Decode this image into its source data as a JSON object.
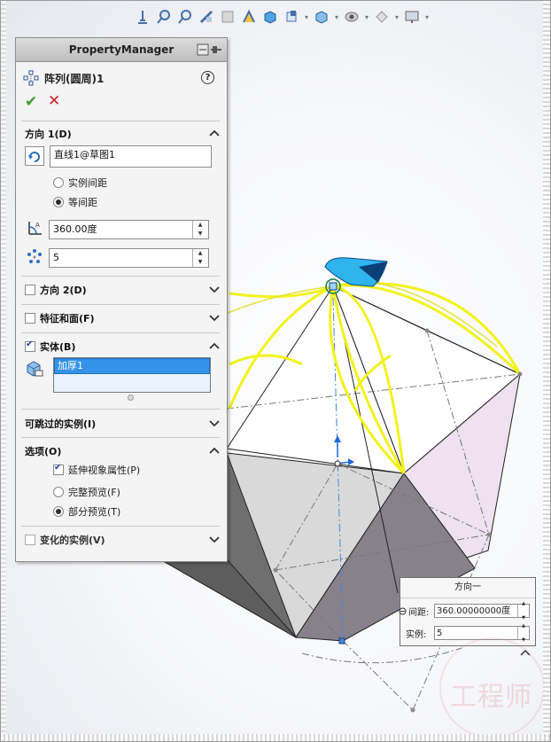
{
  "property_manager": {
    "title": "PropertyManager",
    "feature_name": "阵列(圆周)1",
    "help_icon": "?",
    "ok_icon": "✔",
    "cancel_icon": "✕",
    "direction1": {
      "label": "方向 1(D)",
      "axis_value": "直线1@草图1",
      "option_instance_spacing": "实例间距",
      "option_equal_spacing": "等间距",
      "selected": "等间距",
      "angle_value": "360.00度",
      "count_value": "5"
    },
    "direction2": {
      "label": "方向 2(D)"
    },
    "features_faces": {
      "label": "特征和面(F)"
    },
    "bodies": {
      "label": "实体(B)",
      "items": [
        "加厚1"
      ]
    },
    "skip_instances": {
      "label": "可跳过的实例(I)"
    },
    "options": {
      "label": "选项(O)",
      "propagate_visual": "延伸视象属性(P)",
      "full_preview": "完整预览(F)",
      "partial_preview": "部分预览(T)",
      "selected_preview": "部分预览(T)"
    },
    "varying_instances": {
      "label": "变化的实例(V)"
    }
  },
  "direction_popup": {
    "title": "方向一",
    "spacing_label": "间距:",
    "spacing_value": "360.00000000度",
    "instances_label": "实例:",
    "instances_value": "5"
  },
  "watermark": "工程师",
  "colors": {
    "accent_yellow": "#f2f21c",
    "selection_blue": "#3393e8",
    "ok_green": "#3a9c2b",
    "cancel_red": "#d21d1d",
    "face_pink": "#efe1f0",
    "face_dark": "#87828a"
  }
}
